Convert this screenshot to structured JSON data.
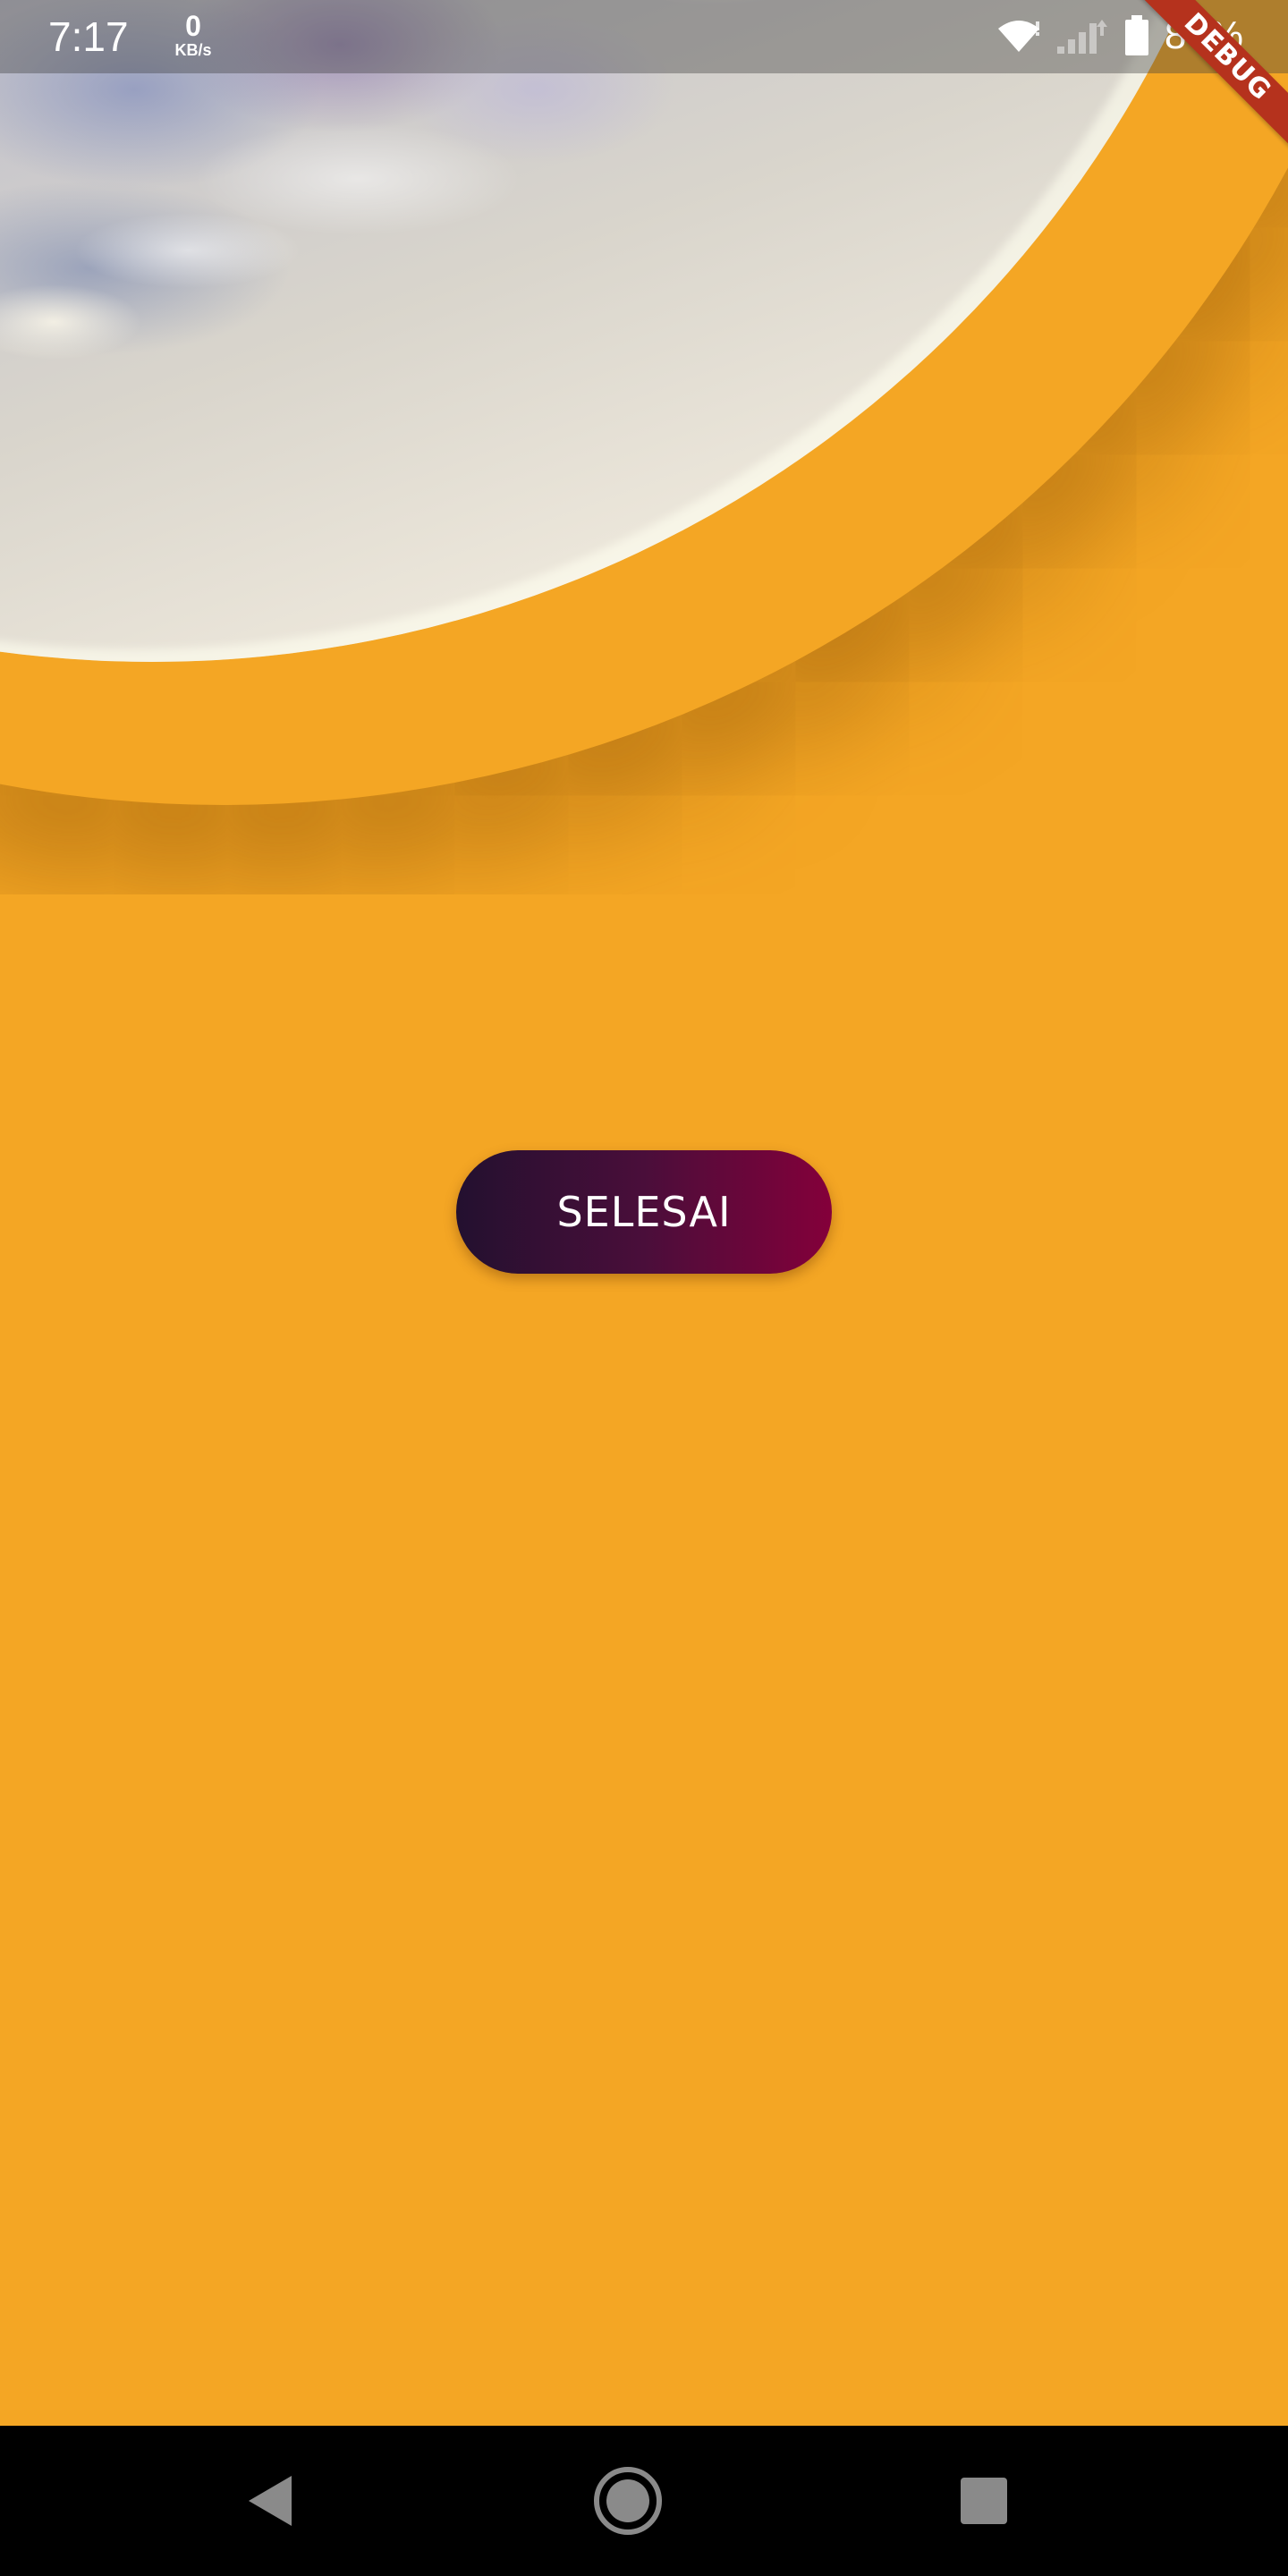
{
  "status_bar": {
    "time": "7:17",
    "net_speed_value": "0",
    "net_speed_unit": "KB/s",
    "battery_percent": "86%",
    "icons": [
      "wifi-icon",
      "signal-icon",
      "battery-icon"
    ]
  },
  "debug_banner": {
    "label": "DEBUG"
  },
  "main": {
    "finish_button_label": "SELESAI"
  },
  "nav_bar": {
    "icons": [
      "back-icon",
      "home-icon",
      "recents-icon"
    ]
  },
  "colors": {
    "background": "#f4a624",
    "button_gradient_start": "#23102f",
    "button_gradient_end": "#84003a",
    "debug_banner": "#b5321d",
    "nav_bar": "#000000"
  }
}
